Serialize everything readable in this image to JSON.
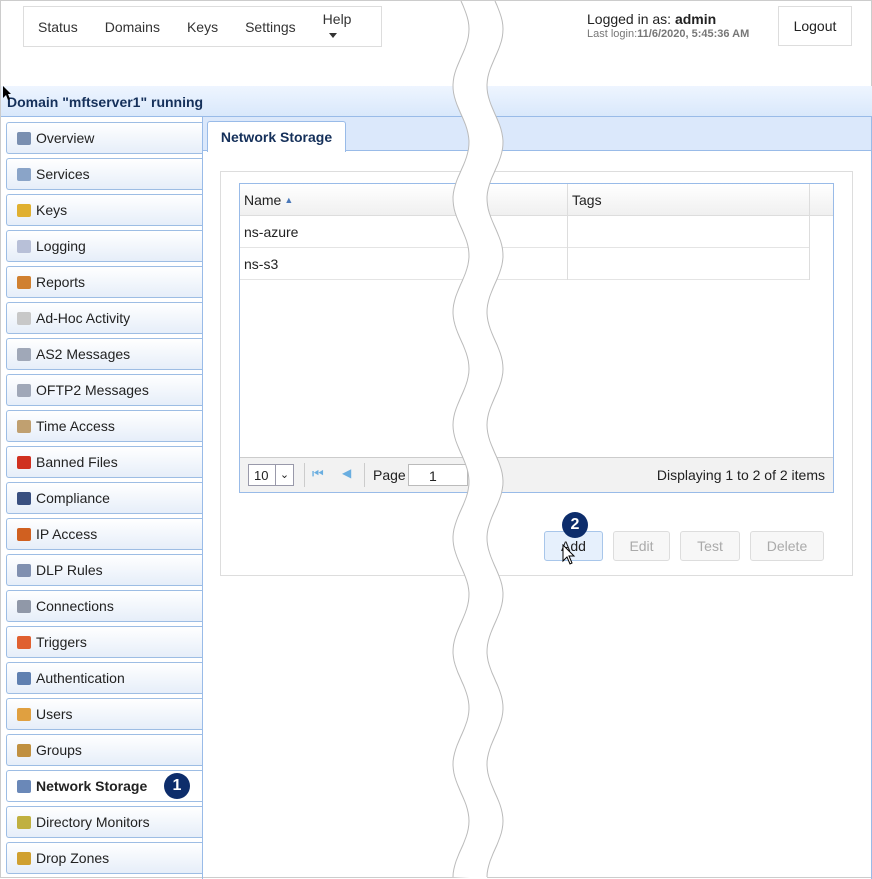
{
  "nav": {
    "items": [
      "Status",
      "Domains",
      "Keys",
      "Settings",
      "Help"
    ]
  },
  "login": {
    "prefix": "Logged in as: ",
    "user": "admin",
    "last_prefix": "Last login:",
    "last": "11/6/2020, 5:45:36 AM",
    "logout": "Logout"
  },
  "header": {
    "title": "Domain \"mftserver1\" running"
  },
  "sidebar": {
    "items": [
      {
        "label": "Overview",
        "icon": "overview-icon",
        "color": "#7a8fb0"
      },
      {
        "label": "Services",
        "icon": "services-icon",
        "color": "#8aa4c8"
      },
      {
        "label": "Keys",
        "icon": "key-icon",
        "color": "#e0b030"
      },
      {
        "label": "Logging",
        "icon": "logging-icon",
        "color": "#b8c0d8"
      },
      {
        "label": "Reports",
        "icon": "reports-icon",
        "color": "#d08030"
      },
      {
        "label": "Ad-Hoc Activity",
        "icon": "envelope-icon",
        "color": "#c8c8c8"
      },
      {
        "label": "AS2 Messages",
        "icon": "as2-icon",
        "color": "#a0a8b8"
      },
      {
        "label": "OFTP2 Messages",
        "icon": "oftp2-icon",
        "color": "#a0a8b8"
      },
      {
        "label": "Time Access",
        "icon": "time-access-icon",
        "color": "#c0a070"
      },
      {
        "label": "Banned Files",
        "icon": "banned-files-icon",
        "color": "#d03020"
      },
      {
        "label": "Compliance",
        "icon": "compliance-icon",
        "color": "#3a5080"
      },
      {
        "label": "IP Access",
        "icon": "ip-access-icon",
        "color": "#d06020"
      },
      {
        "label": "DLP Rules",
        "icon": "shield-icon",
        "color": "#8090b0"
      },
      {
        "label": "Connections",
        "icon": "connections-icon",
        "color": "#9098a8"
      },
      {
        "label": "Triggers",
        "icon": "triggers-icon",
        "color": "#e06030"
      },
      {
        "label": "Authentication",
        "icon": "authentication-icon",
        "color": "#6080b0"
      },
      {
        "label": "Users",
        "icon": "user-icon",
        "color": "#e0a040"
      },
      {
        "label": "Groups",
        "icon": "groups-icon",
        "color": "#c09040"
      },
      {
        "label": "Network Storage",
        "icon": "network-storage-icon",
        "color": "#6a88b8",
        "active": true
      },
      {
        "label": "Directory Monitors",
        "icon": "directory-monitors-icon",
        "color": "#c0b040"
      },
      {
        "label": "Drop Zones",
        "icon": "drop-zones-icon",
        "color": "#d0a030"
      }
    ]
  },
  "tab": {
    "label": "Network Storage"
  },
  "grid": {
    "columns": [
      "Name",
      "Tags"
    ],
    "rows": [
      [
        "ns-azure",
        ""
      ],
      [
        "ns-s3",
        ""
      ]
    ]
  },
  "pager": {
    "page_size": "10",
    "page_label": "Page",
    "page": "1",
    "display": "Displaying 1 to 2 of 2 items"
  },
  "buttons": {
    "add": "Add",
    "edit": "Edit",
    "test": "Test",
    "delete": "Delete"
  },
  "badges": {
    "one": "1",
    "two": "2"
  },
  "colors": {
    "badge": "#0d2d6b",
    "accent": "#99bbe8"
  }
}
